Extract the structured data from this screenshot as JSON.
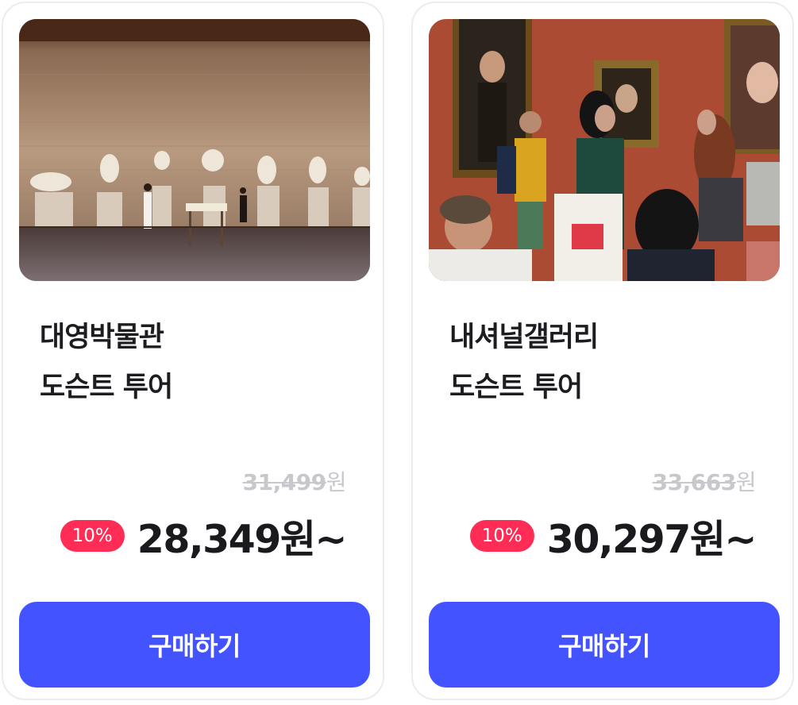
{
  "products": [
    {
      "image_alt": "대영박물관",
      "title_line1": "대영박물관",
      "title_line2": "도슨트 투어",
      "original_price": "31,499",
      "original_price_unit": "원",
      "discount": "10%",
      "price": "28,349원~",
      "buy_label": "구매하기"
    },
    {
      "image_alt": "내셔널갤러리",
      "title_line1": "내셔널갤러리",
      "title_line2": "도슨트 투어",
      "original_price": "33,663",
      "original_price_unit": "원",
      "discount": "10%",
      "price": "30,297원~",
      "buy_label": "구매하기"
    }
  ],
  "colors": {
    "accent_button": "#4253ff",
    "discount_badge": "#ff2d55",
    "strikethrough_price": "#c7c7cc",
    "card_border": "#ececf0"
  }
}
